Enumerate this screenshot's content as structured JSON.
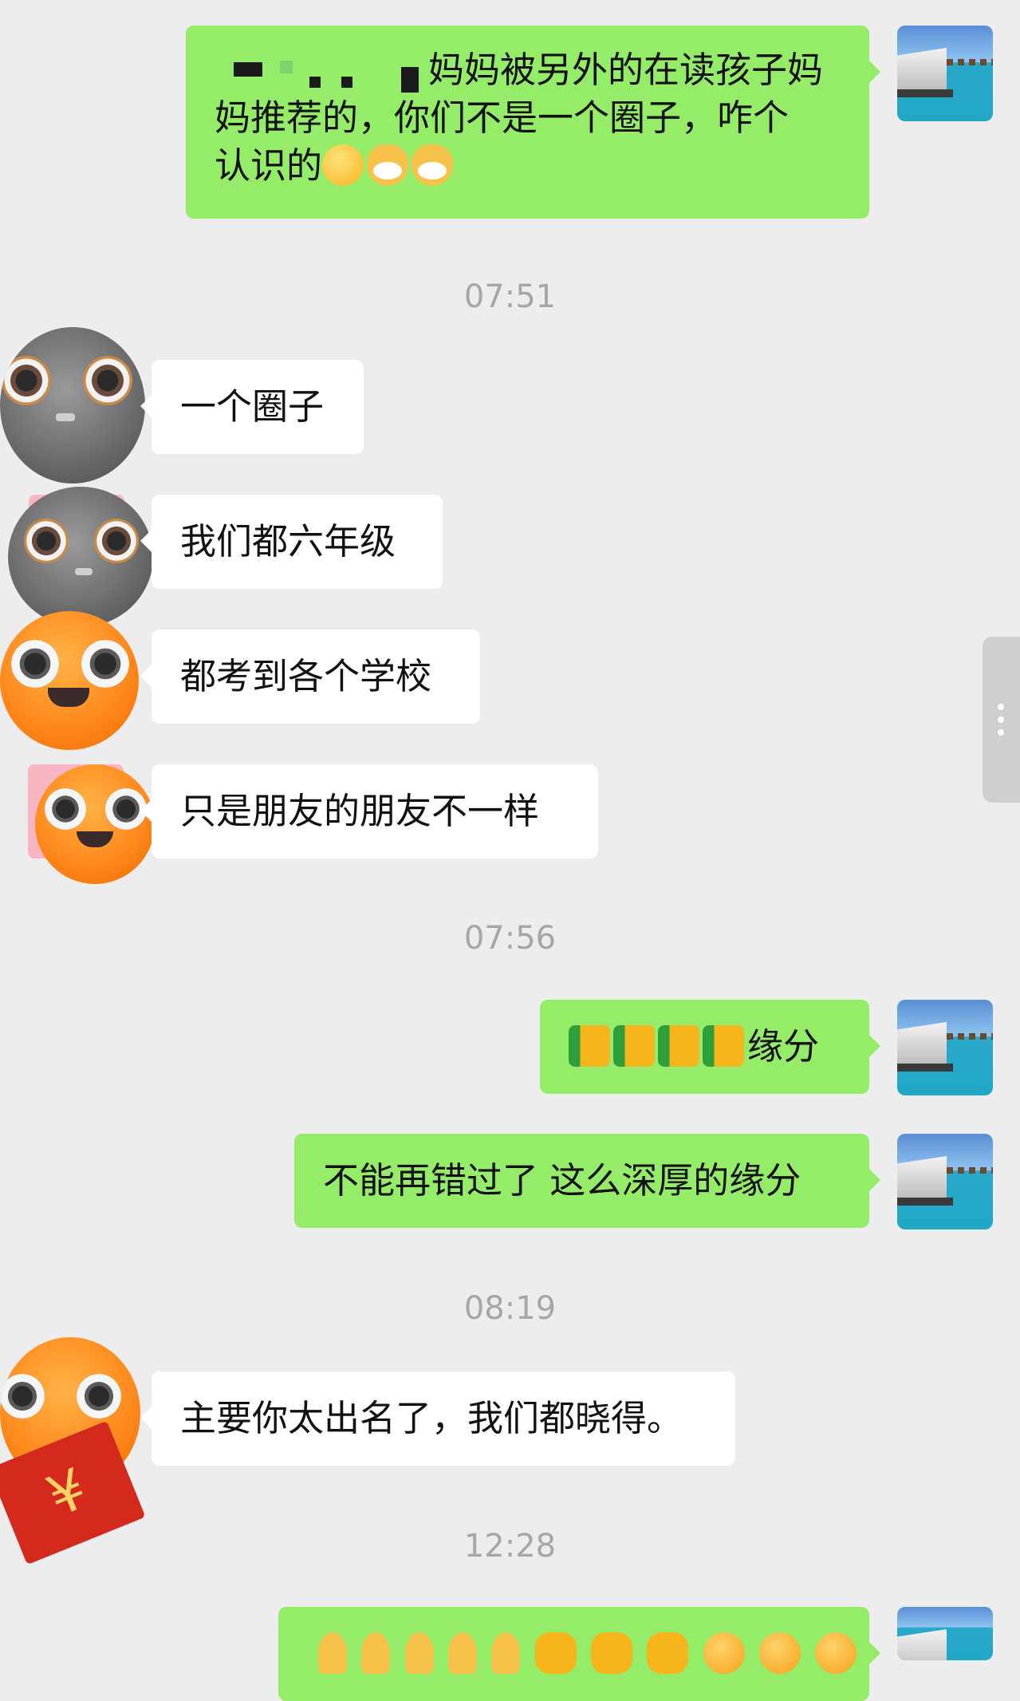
{
  "messages": [
    {
      "type": "out",
      "text_line1": "妈妈被另外的在读孩子妈",
      "text_line2": "妈推荐的，你们不是一个圈子，咋个",
      "text_line3": "认识的",
      "emojis": [
        "pleading-face-emoji",
        "cat-face-emoji",
        "cat-face-emoji"
      ]
    },
    {
      "type": "time",
      "text": "07:51"
    },
    {
      "type": "in",
      "text": "一个圈子"
    },
    {
      "type": "in",
      "text": "我们都六年级"
    },
    {
      "type": "in",
      "text": "都考到各个学校"
    },
    {
      "type": "in",
      "text": "只是朋友的朋友不一样"
    },
    {
      "type": "time",
      "text": "07:56"
    },
    {
      "type": "out",
      "text": "缘分",
      "emojis": [
        "thumbs-up-emoji",
        "thumbs-up-emoji",
        "thumbs-up-emoji",
        "thumbs-up-emoji"
      ]
    },
    {
      "type": "out",
      "text": "不能再错过了 这么深厚的缘分"
    },
    {
      "type": "time",
      "text": "08:19"
    },
    {
      "type": "in",
      "text": "主要你太出名了，我们都晓得。"
    },
    {
      "type": "time",
      "text": "12:28"
    },
    {
      "type": "out",
      "emojis": [
        "folded-hands-emoji",
        "folded-hands-emoji",
        "folded-hands-emoji",
        "folded-hands-emoji",
        "folded-hands-emoji",
        "fist-emoji",
        "fist-emoji",
        "fist-emoji",
        "angry-face-emoji",
        "angry-face-emoji",
        "angry-face-emoji"
      ]
    }
  ],
  "red_envelope_symbol": "¥",
  "colors": {
    "background": "#ededed",
    "outgoing_bubble": "#95ec69",
    "incoming_bubble": "#ffffff",
    "timestamp": "#a6a6a6"
  }
}
